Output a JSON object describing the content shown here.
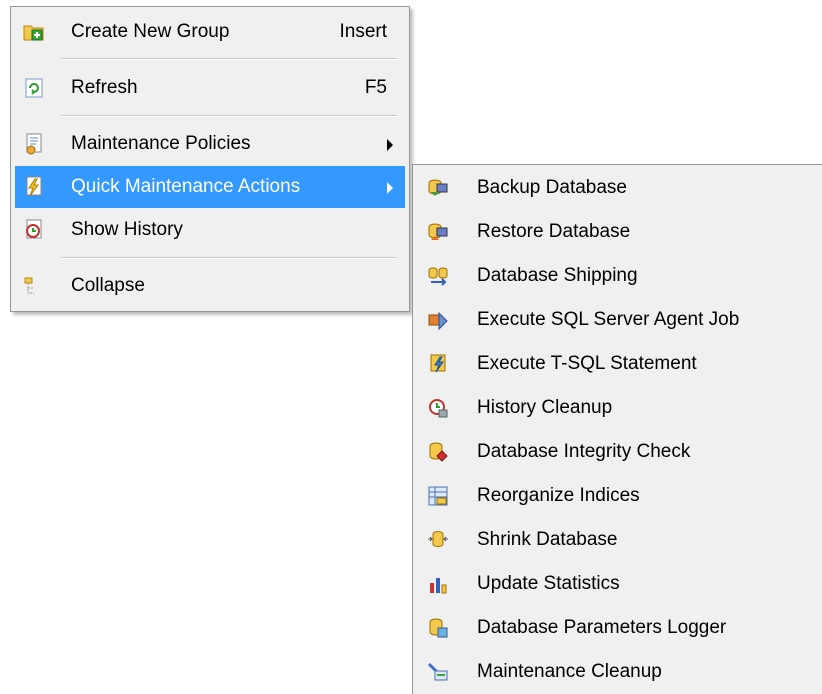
{
  "context_menu": {
    "items": [
      {
        "label": "Create New Group",
        "shortcut": "Insert",
        "icon": "create-group-icon"
      },
      {
        "label": "Refresh",
        "shortcut": "F5",
        "icon": "refresh-icon"
      },
      {
        "label": "Maintenance Policies",
        "icon": "policies-icon"
      },
      {
        "label": "Quick Maintenance Actions",
        "icon": "quick-actions-icon"
      },
      {
        "label": "Show History",
        "icon": "history-icon"
      },
      {
        "label": "Collapse",
        "icon": "collapse-icon"
      }
    ],
    "selected_item": "Quick Maintenance Actions",
    "highlight_color": "#3399ff"
  },
  "submenu": {
    "items": [
      {
        "label": "Backup Database",
        "icon": "backup-database-icon"
      },
      {
        "label": "Restore Database",
        "icon": "restore-database-icon"
      },
      {
        "label": "Database Shipping",
        "icon": "database-shipping-icon"
      },
      {
        "label": "Execute SQL Server Agent Job",
        "icon": "agent-job-icon"
      },
      {
        "label": "Execute T-SQL Statement",
        "icon": "tsql-statement-icon"
      },
      {
        "label": "History Cleanup",
        "icon": "history-cleanup-icon"
      },
      {
        "label": "Database Integrity Check",
        "icon": "integrity-check-icon"
      },
      {
        "label": "Reorganize Indices",
        "icon": "reorganize-indices-icon"
      },
      {
        "label": "Shrink Database",
        "icon": "shrink-database-icon"
      },
      {
        "label": "Update Statistics",
        "icon": "update-statistics-icon"
      },
      {
        "label": "Database Parameters Logger",
        "icon": "parameters-logger-icon"
      },
      {
        "label": "Maintenance Cleanup",
        "icon": "maintenance-cleanup-icon"
      }
    ]
  }
}
